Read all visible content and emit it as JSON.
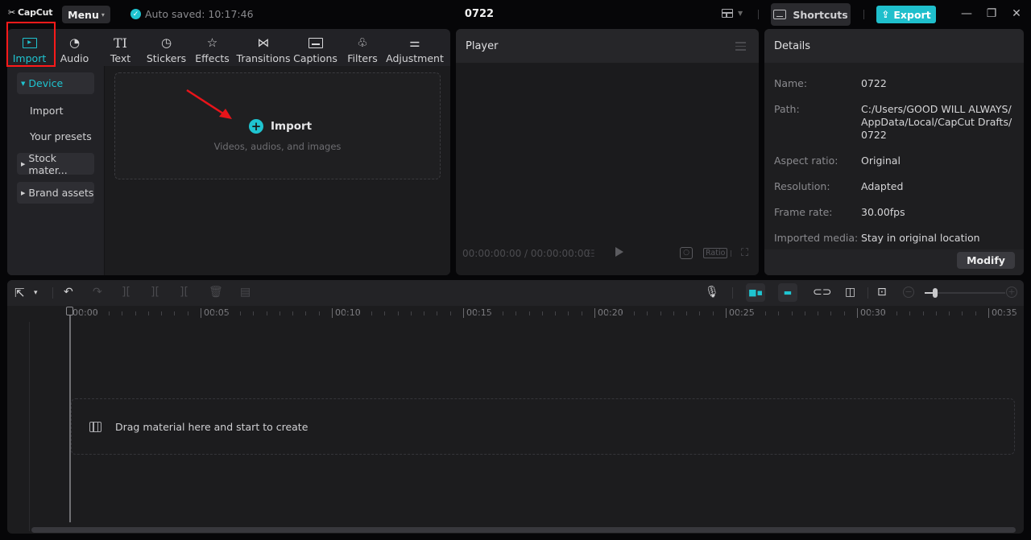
{
  "app": {
    "logo": "CapCut",
    "menu_label": "Menu",
    "autosave": "Auto saved: 10:17:46",
    "project_title": "0722",
    "shortcuts_label": "Shortcuts",
    "export_label": "Export",
    "accent": "#1fc4d0"
  },
  "media": {
    "tabs": [
      {
        "label": "Import",
        "icon": "import-icon",
        "active": true
      },
      {
        "label": "Audio",
        "icon": "audio-icon"
      },
      {
        "label": "Text",
        "icon": "text-icon"
      },
      {
        "label": "Stickers",
        "icon": "stickers-icon"
      },
      {
        "label": "Effects",
        "icon": "effects-icon"
      },
      {
        "label": "Transitions",
        "icon": "transitions-icon"
      },
      {
        "label": "Captions",
        "icon": "captions-icon"
      },
      {
        "label": "Filters",
        "icon": "filters-icon"
      },
      {
        "label": "Adjustment",
        "icon": "adjustment-icon"
      }
    ],
    "sidebar": [
      {
        "label": "Device",
        "kind": "group-open"
      },
      {
        "label": "Import",
        "kind": "active"
      },
      {
        "label": "Your presets",
        "kind": "item"
      },
      {
        "label": "Stock mater...",
        "kind": "group"
      },
      {
        "label": "Brand assets",
        "kind": "group"
      }
    ],
    "import_label": "Import",
    "import_sub": "Videos, audios, and images"
  },
  "player": {
    "title": "Player",
    "timecode": "00:00:00:00 / 00:00:00:00",
    "ratio_label": "Ratio"
  },
  "details": {
    "title": "Details",
    "rows": [
      {
        "label": "Name:",
        "value": "0722"
      },
      {
        "label": "Path:",
        "value": "C:/Users/GOOD WILL ALWAYS/ AppData/Local/CapCut Drafts/ 0722"
      },
      {
        "label": "Aspect ratio:",
        "value": "Original"
      },
      {
        "label": "Resolution:",
        "value": "Adapted"
      },
      {
        "label": "Frame rate:",
        "value": "30.00fps"
      },
      {
        "label": "Imported media:",
        "value": "Stay in original location"
      }
    ],
    "modify_label": "Modify"
  },
  "timeline": {
    "ticks": [
      "00:00",
      "00:05",
      "00:10",
      "00:15",
      "00:20",
      "00:25",
      "00:30",
      "00:35"
    ],
    "drag_hint": "Drag material here and start to create",
    "zoom_level": 0.1
  }
}
